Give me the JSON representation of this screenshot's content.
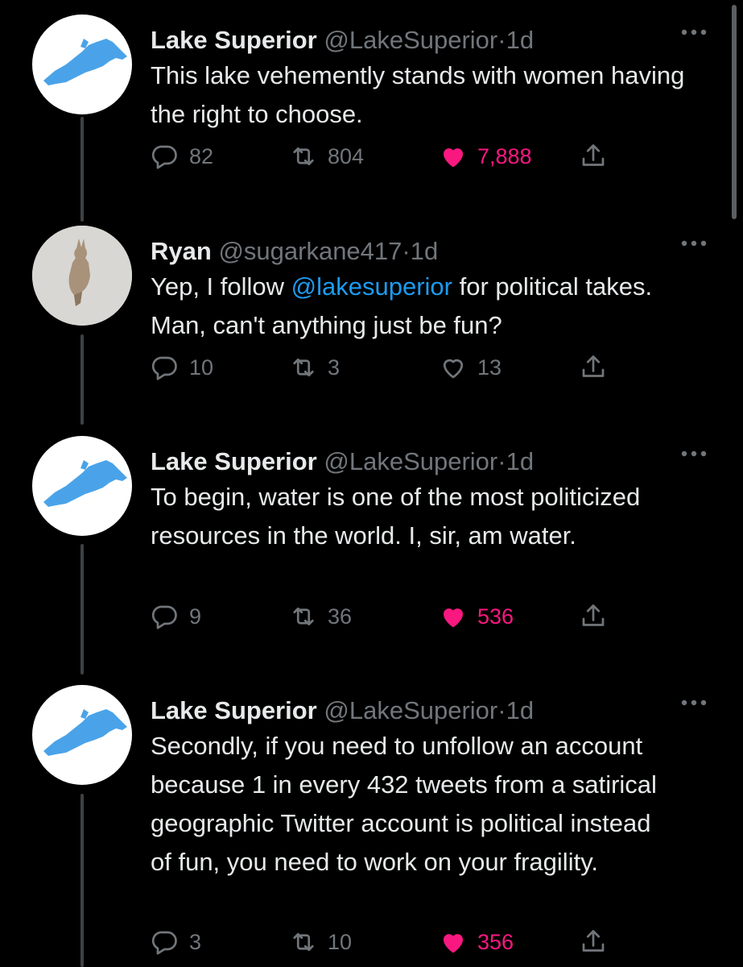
{
  "tweets": [
    {
      "name": "Lake Superior",
      "handle": "@LakeSuperior",
      "dot": "·",
      "time": "1d",
      "text_before": "This lake vehemently stands with women having the right to choose.",
      "mention": "",
      "text_after": "",
      "replies": "82",
      "retweets": "804",
      "likes": "7,888",
      "liked": true,
      "avatar_icon": "lake-superior-map-icon"
    },
    {
      "name": "Ryan",
      "handle": "@sugarkane417",
      "dot": "·",
      "time": "1d",
      "text_before": "Yep, I follow ",
      "mention": "@lakesuperior",
      "text_after": " for political takes.  Man, can't anything just be fun?",
      "replies": "10",
      "retweets": "3",
      "likes": "13",
      "liked": false,
      "avatar_icon": "kangaroo-avatar-icon"
    },
    {
      "name": "Lake Superior",
      "handle": "@LakeSuperior",
      "dot": "·",
      "time": "1d",
      "text_before": "To begin, water is one of the most politicized resources in the world. I, sir, am water.",
      "mention": "",
      "text_after": "",
      "replies": "9",
      "retweets": "36",
      "likes": "536",
      "liked": true,
      "avatar_icon": "lake-superior-map-icon"
    },
    {
      "name": "Lake Superior",
      "handle": "@LakeSuperior",
      "dot": "·",
      "time": "1d",
      "text_before": "Secondly, if you need to unfollow an account because 1 in every 432 tweets from a satirical geographic Twitter account is political instead of fun, you need to work on your fragility.",
      "mention": "",
      "text_after": "",
      "replies": "3",
      "retweets": "10",
      "likes": "356",
      "liked": true,
      "avatar_icon": "lake-superior-map-icon"
    }
  ],
  "colors": {
    "background": "#000000",
    "text": "#e7e9ea",
    "muted": "#71767b",
    "like": "#f91880",
    "link": "#1d9bf0",
    "lake": "#4aa3e8"
  }
}
